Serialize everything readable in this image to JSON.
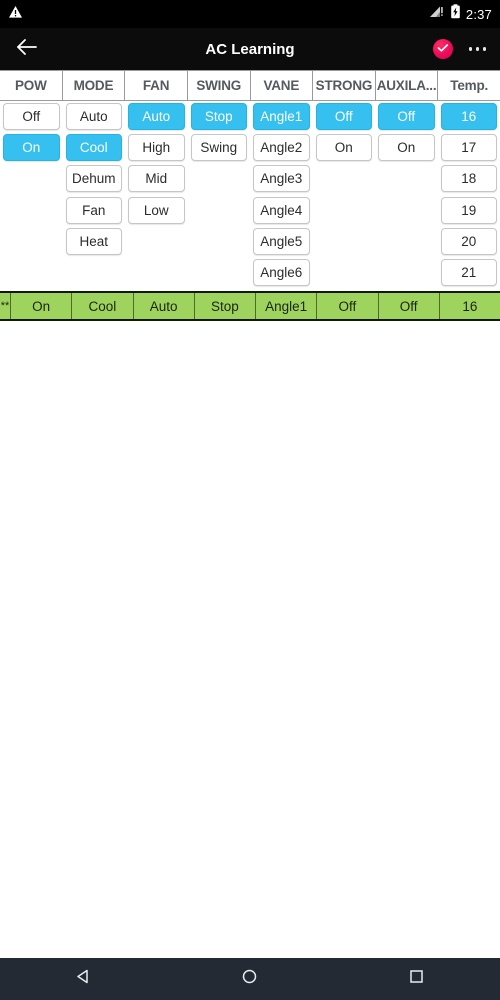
{
  "status_bar": {
    "warning_icon": "warning-triangle-icon",
    "signal_icon": "signal-no-sim-icon",
    "battery_icon": "battery-charging-icon",
    "time": "2:37"
  },
  "app_bar": {
    "back_icon": "arrow-back-icon",
    "title": "AC Learning",
    "confirm_icon": "check-icon",
    "overflow_icon": "more-options-icon"
  },
  "colors": {
    "selected": "#35c0ef",
    "summary_bar": "#9ed45e",
    "accent": "#ec0b5a",
    "status_bar": "#000000",
    "nav_bar": "#232a33"
  },
  "table": {
    "headers": [
      "POW",
      "MODE",
      "FAN",
      "SWING",
      "VANE",
      "STRONG",
      "AUXILA...",
      "Temp."
    ],
    "columns": [
      {
        "key": "POW",
        "options": [
          "Off",
          "On"
        ],
        "selected": "On"
      },
      {
        "key": "MODE",
        "options": [
          "Auto",
          "Cool",
          "Dehum",
          "Fan",
          "Heat"
        ],
        "selected": "Cool"
      },
      {
        "key": "FAN",
        "options": [
          "Auto",
          "High",
          "Mid",
          "Low"
        ],
        "selected": "Auto"
      },
      {
        "key": "SWING",
        "options": [
          "Stop",
          "Swing"
        ],
        "selected": "Stop"
      },
      {
        "key": "VANE",
        "options": [
          "Angle1",
          "Angle2",
          "Angle3",
          "Angle4",
          "Angle5",
          "Angle6"
        ],
        "selected": "Angle1"
      },
      {
        "key": "STRONG",
        "options": [
          "Off",
          "On"
        ],
        "selected": "Off"
      },
      {
        "key": "AUXILA",
        "options": [
          "Off",
          "On"
        ],
        "selected": "Off"
      },
      {
        "key": "Temp",
        "options": [
          "16",
          "17",
          "18",
          "19",
          "20",
          "21"
        ],
        "selected": "16"
      }
    ],
    "rows": [
      [
        "Off",
        "Auto",
        "Auto",
        "Stop",
        "Angle1",
        "Off",
        "Off",
        "16"
      ],
      [
        "On",
        "Cool",
        "High",
        "Swing",
        "Angle2",
        "On",
        "On",
        "17"
      ],
      [
        "",
        "Dehum",
        "Mid",
        "",
        "Angle3",
        "",
        "",
        "18"
      ],
      [
        "",
        "Fan",
        "Low",
        "",
        "Angle4",
        "",
        "",
        "19"
      ],
      [
        "",
        "Heat",
        "",
        "",
        "Angle5",
        "",
        "",
        "20"
      ],
      [
        "",
        "",
        "",
        "",
        "Angle6",
        "",
        "",
        "21"
      ]
    ],
    "selected_row_index_per_column": [
      1,
      1,
      0,
      0,
      0,
      0,
      0,
      0
    ]
  },
  "summary": {
    "index_label": "**",
    "values": [
      "On",
      "Cool",
      "Auto",
      "Stop",
      "Angle1",
      "Off",
      "Off",
      "16"
    ]
  },
  "nav_bar": {
    "back_icon": "nav-back-triangle-icon",
    "home_icon": "nav-home-circle-icon",
    "recents_icon": "nav-recents-square-icon"
  }
}
